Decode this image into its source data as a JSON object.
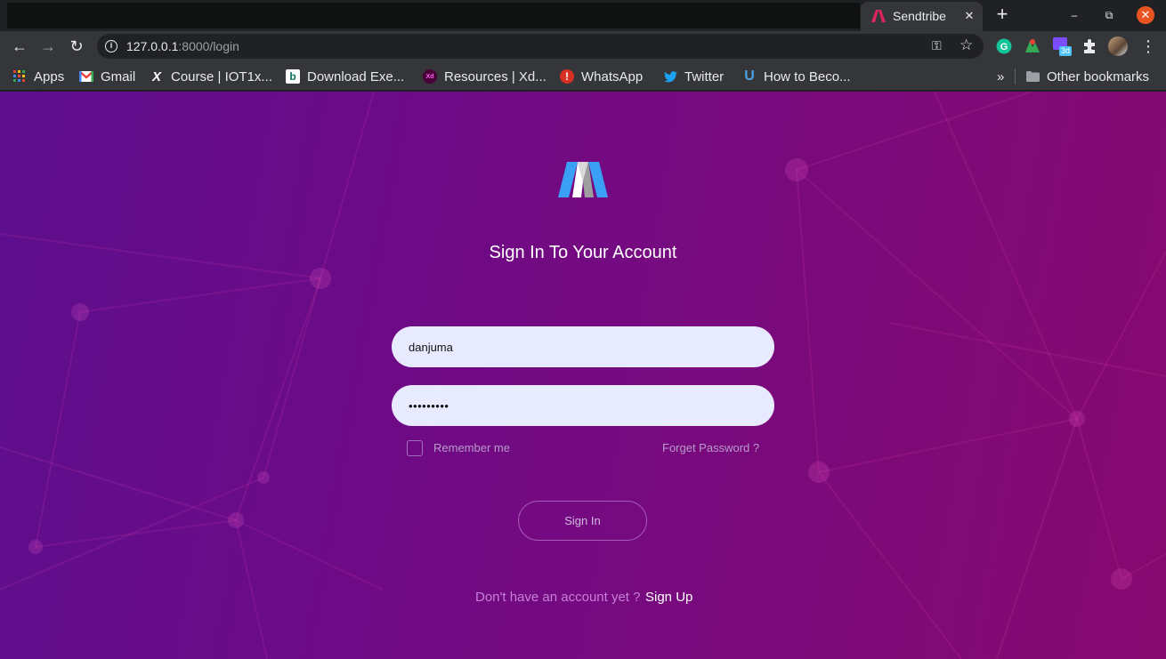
{
  "browser": {
    "tab": {
      "title": "Sendtribe",
      "close_glyph": "✕"
    },
    "new_tab_glyph": "+",
    "window": {
      "minimize": "–",
      "maximize": "⧉",
      "close": "✕"
    },
    "nav": {
      "back": "←",
      "forward": "→",
      "reload": "↻"
    },
    "omnibox": {
      "host": "127.0.0.1",
      "path": ":8000/login",
      "key_icon": "key-icon",
      "star_icon": "star-icon"
    },
    "extensions": [
      "grammarly-icon",
      "maps-extension-icon",
      "calendar-extension-icon",
      "puzzle-icon",
      "profile-avatar"
    ],
    "extension_badge": "3d",
    "menu_glyph": "⋮",
    "bookmarks": [
      {
        "label": "Apps",
        "icon": "apps-grid-icon"
      },
      {
        "label": "Gmail",
        "icon": "gmail-icon"
      },
      {
        "label": "Course | IOT1x...",
        "icon": "edx-icon"
      },
      {
        "label": "Download Exe...",
        "icon": "download-icon"
      },
      {
        "label": "Resources | Xd...",
        "icon": "xd-icon"
      },
      {
        "label": "WhatsApp",
        "icon": "whatsapp-icon"
      },
      {
        "label": "Twitter",
        "icon": "twitter-icon"
      },
      {
        "label": "How to Beco...",
        "icon": "udemy-icon"
      }
    ],
    "overflow_glyph": "»",
    "other_bookmarks": "Other bookmarks"
  },
  "login": {
    "heading": "Sign In To Your Account",
    "username_value": "danjuma",
    "password_value": "•••••••••",
    "remember_label": "Remember me",
    "forgot_label": "Forget Password ?",
    "signin_label": "Sign In",
    "no_account_text": "Don't have an account yet ?",
    "signup_label": "Sign Up"
  },
  "colors": {
    "page_bg_start": "#5d0f8e",
    "page_bg_end": "#86096f",
    "input_bg": "#e8eaff",
    "accent_text": "#c87fd8",
    "logo_blue": "#3aa0f5"
  }
}
